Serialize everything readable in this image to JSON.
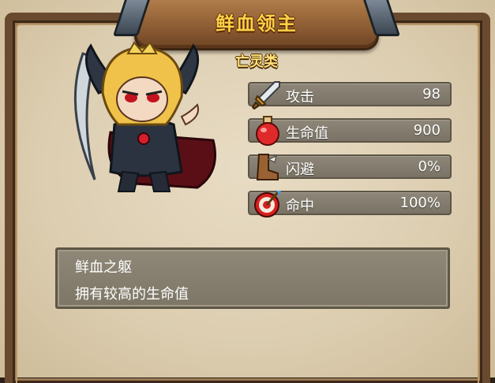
{
  "hero": {
    "name": "鲜血领主",
    "type": "亡灵类"
  },
  "stats": [
    {
      "label": "攻击",
      "value": "98",
      "icon": "sword-icon"
    },
    {
      "label": "生命值",
      "value": "900",
      "icon": "potion-icon"
    },
    {
      "label": "闪避",
      "value": "0%",
      "icon": "boot-icon"
    },
    {
      "label": "命中",
      "value": "100%",
      "icon": "target-icon"
    }
  ],
  "skill": {
    "name": "鲜血之躯",
    "description": "拥有较高的生命值"
  },
  "colors": {
    "title": "#ffd24a",
    "panel": "#dccdb0",
    "stat_bar": "#857e70"
  }
}
